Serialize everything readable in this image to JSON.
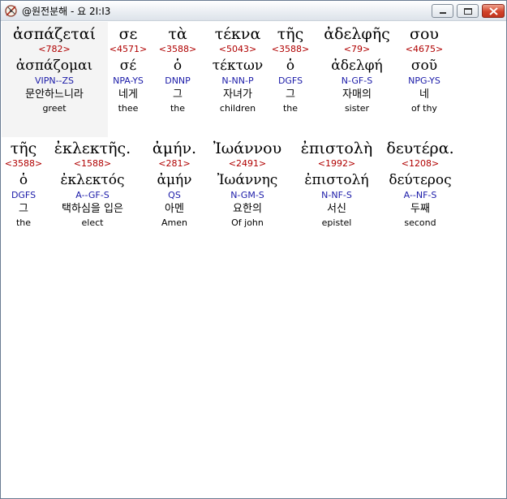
{
  "window": {
    "title": "@원전분해 - 요 2I:I3",
    "icon": "app-compass-icon",
    "controls": [
      "minimize",
      "maximize",
      "close"
    ]
  },
  "lines": [
    {
      "words": [
        {
          "greek": "ἀσπάζεταί",
          "strong": "<782>",
          "lemma": "ἀσπάζομαι",
          "parse": "VIPN--ZS",
          "korean": "문안하느니라",
          "english": "greet",
          "selected": true
        },
        {
          "greek": "σε",
          "strong": "<4571>",
          "lemma": "σέ",
          "parse": "NPA-YS",
          "korean": "네게",
          "english": "thee"
        },
        {
          "greek": "τὰ",
          "strong": "<3588>",
          "lemma": "ὁ",
          "parse": "DNNP",
          "korean": "그",
          "english": "the"
        },
        {
          "greek": "τέκνα",
          "strong": "<5043>",
          "lemma": "τέκτων",
          "parse": "N-NN-P",
          "korean": "자녀가",
          "english": "children"
        },
        {
          "greek": "τῆς",
          "strong": "<3588>",
          "lemma": "ὁ",
          "parse": "DGFS",
          "korean": "그",
          "english": "the"
        },
        {
          "greek": "ἀδελφῆς",
          "strong": "<79>",
          "lemma": "ἀδελφή",
          "parse": "N-GF-S",
          "korean": "자매의",
          "english": "sister"
        },
        {
          "greek": "σου",
          "strong": "<4675>",
          "lemma": "σοῦ",
          "parse": "NPG-YS",
          "korean": "네",
          "english": "of thy"
        }
      ]
    },
    {
      "words": [
        {
          "greek": "τῆς",
          "strong": "<3588>",
          "lemma": "ὁ",
          "parse": "DGFS",
          "korean": "그",
          "english": "the"
        },
        {
          "greek": "ἐκλεκτῆς.",
          "strong": "<1588>",
          "lemma": "ἐκλεκτός",
          "parse": "A--GF-S",
          "korean": "택하심을 입은",
          "english": "elect"
        },
        {
          "greek": "ἀμήν.",
          "strong": "<281>",
          "lemma": "ἀμήν",
          "parse": "QS",
          "korean": "아멘",
          "english": "Amen"
        },
        {
          "greek": "Ἰωάννου",
          "strong": "<2491>",
          "lemma": "Ἰωάννης",
          "parse": "N-GM-S",
          "korean": "요한의",
          "english": "Of john"
        },
        {
          "greek": "ἐπιστολὴ",
          "strong": "<1992>",
          "lemma": "ἐπιστολή",
          "parse": "N-NF-S",
          "korean": "서신",
          "english": "epistel"
        },
        {
          "greek": "δευτέρα.",
          "strong": "<1208>",
          "lemma": "δεύτερος",
          "parse": "A--NF-S",
          "korean": "두째",
          "english": "second"
        }
      ]
    }
  ]
}
